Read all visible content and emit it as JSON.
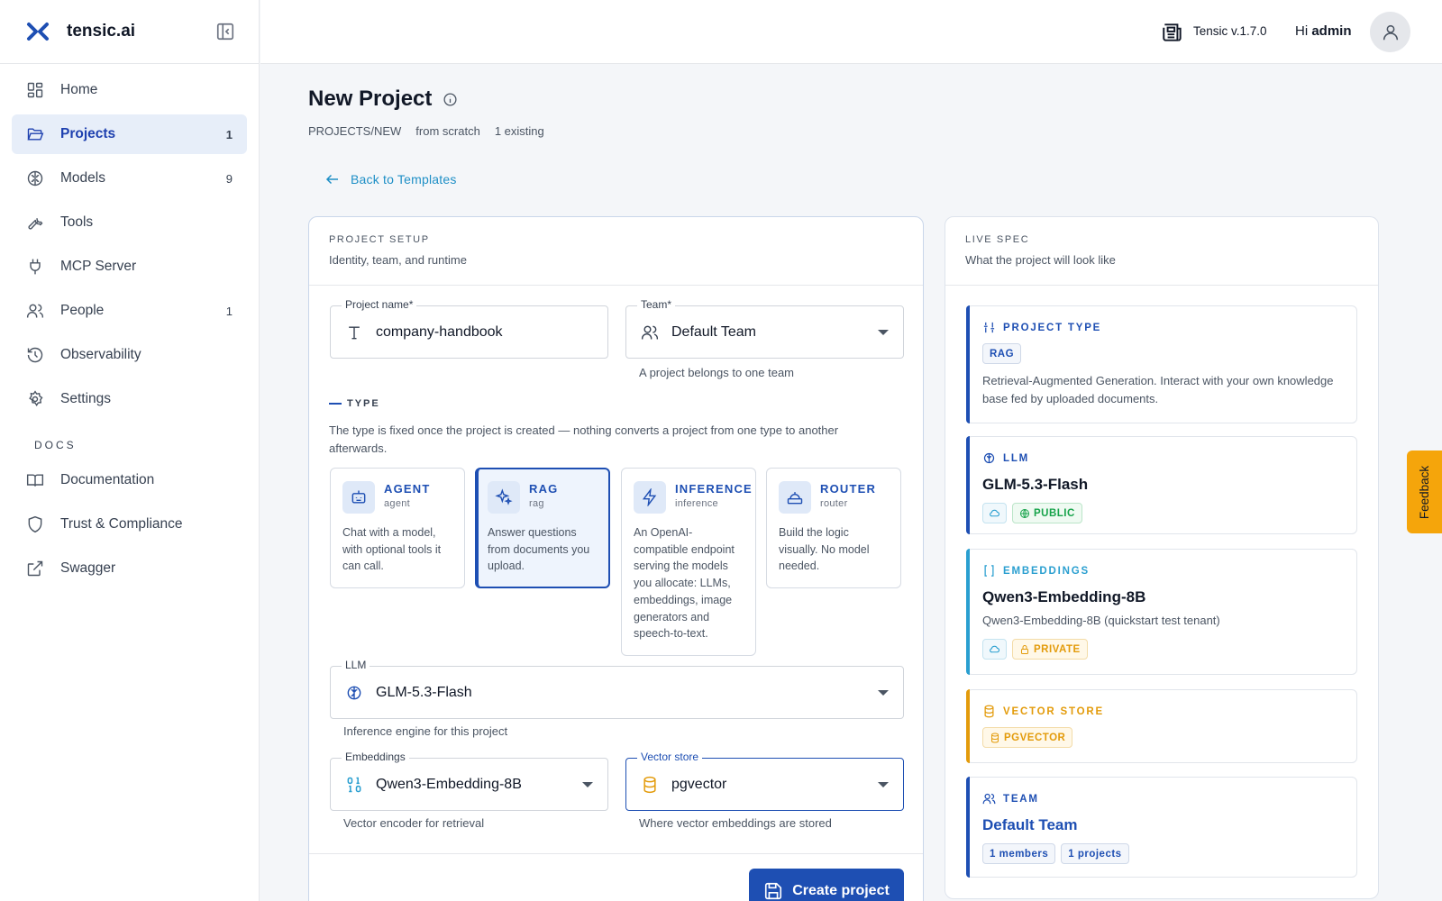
{
  "app": {
    "name": "tensic.ai",
    "version": "Tensic v.1.7.0",
    "greeting": "Hi",
    "user": "admin"
  },
  "sidebar": {
    "items": [
      {
        "label": "Home",
        "count": "",
        "icon": "dashboard-icon"
      },
      {
        "label": "Projects",
        "count": "1",
        "icon": "folder-open-icon",
        "active": true
      },
      {
        "label": "Models",
        "count": "9",
        "icon": "brain-icon"
      },
      {
        "label": "Tools",
        "count": "",
        "icon": "wrench-icon"
      },
      {
        "label": "MCP Server",
        "count": "",
        "icon": "plug-icon"
      },
      {
        "label": "People",
        "count": "1",
        "icon": "users-icon"
      },
      {
        "label": "Observability",
        "count": "",
        "icon": "history-icon"
      },
      {
        "label": "Settings",
        "count": "",
        "icon": "gear-icon"
      }
    ],
    "docs_header": "DOCS",
    "docs": [
      {
        "label": "Documentation",
        "icon": "book-icon"
      },
      {
        "label": "Trust & Compliance",
        "icon": "shield-icon"
      },
      {
        "label": "Swagger",
        "icon": "external-link-icon"
      }
    ]
  },
  "header": {
    "title": "New Project",
    "crumbs": [
      "PROJECTS/NEW",
      "from scratch",
      "1 existing"
    ],
    "back_label": "Back to Templates"
  },
  "setup": {
    "kicker": "PROJECT SETUP",
    "subtitle": "Identity, team, and runtime",
    "project_name": {
      "label": "Project name",
      "value": "company-handbook"
    },
    "team": {
      "label": "Team",
      "value": "Default Team",
      "helper": "A project belongs to one team"
    },
    "type_header": "TYPE",
    "type_desc": "The type is fixed once the project is created — nothing converts a project from one type to another afterwards.",
    "types": [
      {
        "name": "AGENT",
        "sub": "agent",
        "desc": "Chat with a model, with optional tools it can call.",
        "icon": "robot-icon"
      },
      {
        "name": "RAG",
        "sub": "rag",
        "desc": "Answer questions from documents you upload.",
        "icon": "sparkles-icon",
        "selected": true
      },
      {
        "name": "INFERENCE",
        "sub": "inference",
        "desc": "An OpenAI-compatible endpoint serving the models you allocate: LLMs, embeddings, image generators and speech-to-text.",
        "icon": "lightning-icon"
      },
      {
        "name": "ROUTER",
        "sub": "router",
        "desc": "Build the logic visually. No model needed.",
        "icon": "router-icon"
      }
    ],
    "llm": {
      "label": "LLM",
      "value": "GLM-5.3-Flash",
      "helper": "Inference engine for this project"
    },
    "embeddings": {
      "label": "Embeddings",
      "value": "Qwen3-Embedding-8B",
      "helper": "Vector encoder for retrieval"
    },
    "vector_store": {
      "label": "Vector store",
      "value": "pgvector",
      "helper": "Where vector embeddings are stored"
    },
    "create_label": "Create project"
  },
  "spec": {
    "kicker": "LIVE SPEC",
    "subtitle": "What the project will look like",
    "project_type": {
      "header": "PROJECT TYPE",
      "badge": "RAG",
      "desc": "Retrieval-Augmented Generation. Interact with your own knowledge base fed by uploaded documents."
    },
    "llm": {
      "header": "LLM",
      "name": "GLM-5.3-Flash",
      "badge": "PUBLIC"
    },
    "embeddings": {
      "header": "EMBEDDINGS",
      "name": "Qwen3-Embedding-8B",
      "desc": "Qwen3-Embedding-8B (quickstart test tenant)",
      "badge": "PRIVATE"
    },
    "vector_store": {
      "header": "VECTOR STORE",
      "badge": "PGVECTOR"
    },
    "team": {
      "header": "TEAM",
      "name": "Default Team",
      "badges": [
        "1 members",
        "1 projects"
      ]
    }
  },
  "feedback_label": "Feedback",
  "colors": {
    "primary": "#1e4fb3",
    "link": "#1e8fc6",
    "public": "#16a34a",
    "private": "#e39b0b",
    "feedback": "#f5a50b"
  }
}
